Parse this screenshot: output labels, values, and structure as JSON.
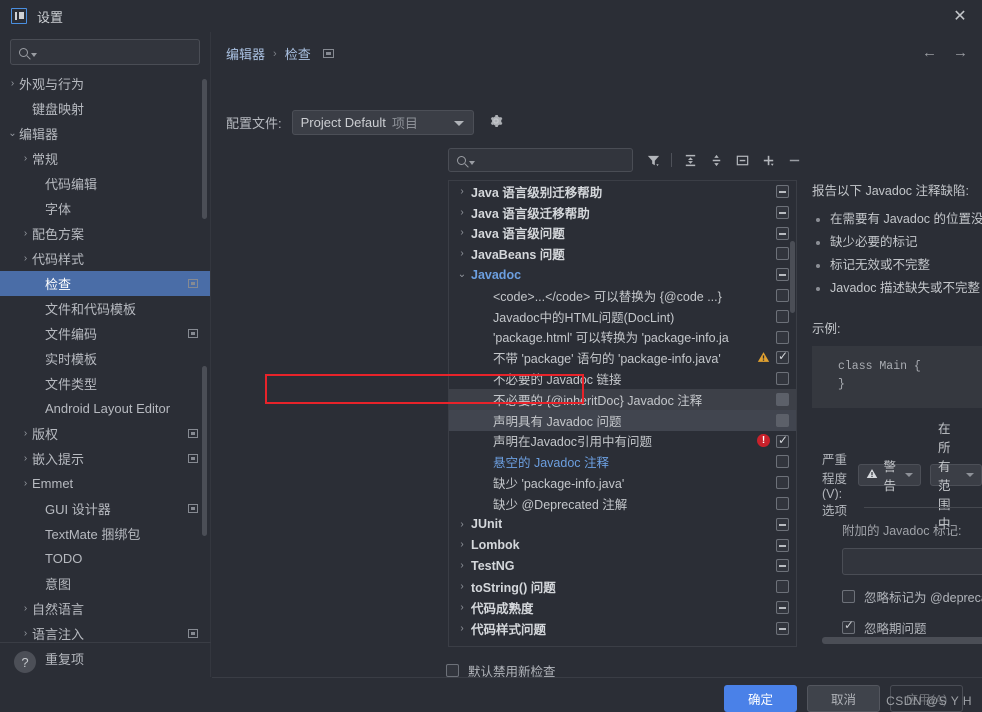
{
  "window": {
    "title": "设置",
    "app_icon": "intellij-idea-icon",
    "close_label": "✕"
  },
  "sidebar": {
    "search_placeholder": "",
    "items": [
      {
        "label": "外观与行为",
        "arrow": "›",
        "indent": 0,
        "selected": false,
        "badge": false
      },
      {
        "label": "键盘映射",
        "arrow": "",
        "indent": 1,
        "selected": false,
        "badge": false
      },
      {
        "label": "编辑器",
        "arrow": "⌄",
        "indent": 0,
        "selected": false,
        "badge": false
      },
      {
        "label": "常规",
        "arrow": "›",
        "indent": 1,
        "selected": false,
        "badge": false
      },
      {
        "label": "代码编辑",
        "arrow": "",
        "indent": 2,
        "selected": false,
        "badge": false
      },
      {
        "label": "字体",
        "arrow": "",
        "indent": 2,
        "selected": false,
        "badge": false
      },
      {
        "label": "配色方案",
        "arrow": "›",
        "indent": 1,
        "selected": false,
        "badge": false
      },
      {
        "label": "代码样式",
        "arrow": "›",
        "indent": 1,
        "selected": false,
        "badge": false
      },
      {
        "label": "检查",
        "arrow": "",
        "indent": 2,
        "selected": true,
        "badge": true
      },
      {
        "label": "文件和代码模板",
        "arrow": "",
        "indent": 2,
        "selected": false,
        "badge": false
      },
      {
        "label": "文件编码",
        "arrow": "",
        "indent": 2,
        "selected": false,
        "badge": true
      },
      {
        "label": "实时模板",
        "arrow": "",
        "indent": 2,
        "selected": false,
        "badge": false
      },
      {
        "label": "文件类型",
        "arrow": "",
        "indent": 2,
        "selected": false,
        "badge": false
      },
      {
        "label": "Android Layout Editor",
        "arrow": "",
        "indent": 2,
        "selected": false,
        "badge": false
      },
      {
        "label": "版权",
        "arrow": "›",
        "indent": 1,
        "selected": false,
        "badge": true
      },
      {
        "label": "嵌入提示",
        "arrow": "›",
        "indent": 1,
        "selected": false,
        "badge": true
      },
      {
        "label": "Emmet",
        "arrow": "›",
        "indent": 1,
        "selected": false,
        "badge": false
      },
      {
        "label": "GUI 设计器",
        "arrow": "",
        "indent": 2,
        "selected": false,
        "badge": true
      },
      {
        "label": "TextMate 捆绑包",
        "arrow": "",
        "indent": 2,
        "selected": false,
        "badge": false
      },
      {
        "label": "TODO",
        "arrow": "",
        "indent": 2,
        "selected": false,
        "badge": false
      },
      {
        "label": "意图",
        "arrow": "",
        "indent": 2,
        "selected": false,
        "badge": false
      },
      {
        "label": "自然语言",
        "arrow": "›",
        "indent": 1,
        "selected": false,
        "badge": false
      },
      {
        "label": "语言注入",
        "arrow": "›",
        "indent": 1,
        "selected": false,
        "badge": true
      },
      {
        "label": "重复项",
        "arrow": "",
        "indent": 2,
        "selected": false,
        "badge": false
      }
    ],
    "help_label": "?"
  },
  "main": {
    "breadcrumb": {
      "parent": "编辑器",
      "separator": "›",
      "current": "检查"
    },
    "nav": {
      "back": "←",
      "forward": "→"
    },
    "profile": {
      "label": "配置文件:",
      "value": "Project Default",
      "value_sub": "项目",
      "gear": "gear-icon"
    },
    "inspection_search_placeholder": "",
    "toolbar": [
      {
        "name": "filter-icon",
        "glyph": "filter"
      },
      {
        "name": "expand-all-icon",
        "glyph": "expand"
      },
      {
        "name": "collapse-all-icon",
        "glyph": "collapse"
      },
      {
        "name": "reset-icon",
        "glyph": "reset"
      },
      {
        "name": "add-icon",
        "glyph": "plus"
      },
      {
        "name": "remove-icon",
        "glyph": "minus"
      }
    ],
    "tree": [
      {
        "label": "Java 语言级别迁移帮助",
        "arrow": "›",
        "indent": 0,
        "group": true,
        "check": "dash",
        "state": ""
      },
      {
        "label": "Java 语言级迁移帮助",
        "arrow": "›",
        "indent": 0,
        "group": true,
        "check": "dash",
        "state": ""
      },
      {
        "label": "Java 语言级问题",
        "arrow": "›",
        "indent": 0,
        "group": true,
        "check": "dash",
        "state": ""
      },
      {
        "label": "JavaBeans 问题",
        "arrow": "›",
        "indent": 0,
        "group": true,
        "check": "empty",
        "state": ""
      },
      {
        "label": "Javadoc",
        "arrow": "⌄",
        "indent": 0,
        "group": true,
        "blue": true,
        "check": "dash",
        "state": ""
      },
      {
        "label": "<code>...</code> 可以替换为 {@code ...}",
        "arrow": "",
        "indent": 1,
        "group": false,
        "check": "empty",
        "state": ""
      },
      {
        "label": "Javadoc中的HTML问题(DocLint)",
        "arrow": "",
        "indent": 1,
        "group": false,
        "check": "empty",
        "state": ""
      },
      {
        "label": "'package.html' 可以转换为 'package-info.ja",
        "arrow": "",
        "indent": 1,
        "group": false,
        "check": "empty",
        "state": ""
      },
      {
        "label": "不带 'package' 语句的 'package-info.java'",
        "arrow": "",
        "indent": 1,
        "group": false,
        "check": "checked",
        "state": "",
        "icon": "warning"
      },
      {
        "label": "不必要的 Javadoc 链接",
        "arrow": "",
        "indent": 1,
        "group": false,
        "check": "empty",
        "state": ""
      },
      {
        "label": "不必要的 {@inheritDoc} Javadoc 注释",
        "arrow": "",
        "indent": 1,
        "group": false,
        "check": "filled",
        "state": "hover"
      },
      {
        "label": "声明具有 Javadoc 问题",
        "arrow": "",
        "indent": 1,
        "group": false,
        "check": "filled",
        "state": "active"
      },
      {
        "label": "声明在Javadoc引用中有问题",
        "arrow": "",
        "indent": 1,
        "group": false,
        "check": "checked",
        "state": "",
        "icon": "error"
      },
      {
        "label": "悬空的 Javadoc 注释",
        "arrow": "",
        "indent": 1,
        "group": false,
        "check": "empty",
        "state": "",
        "link": true
      },
      {
        "label": "缺少 'package-info.java'",
        "arrow": "",
        "indent": 1,
        "group": false,
        "check": "empty",
        "state": ""
      },
      {
        "label": "缺少 @Deprecated 注解",
        "arrow": "",
        "indent": 1,
        "group": false,
        "check": "empty",
        "state": ""
      },
      {
        "label": "JUnit",
        "arrow": "›",
        "indent": 0,
        "group": true,
        "check": "dash",
        "state": ""
      },
      {
        "label": "Lombok",
        "arrow": "›",
        "indent": 0,
        "group": true,
        "check": "dash",
        "state": ""
      },
      {
        "label": "TestNG",
        "arrow": "›",
        "indent": 0,
        "group": true,
        "check": "dash",
        "state": ""
      },
      {
        "label": "toString() 问题",
        "arrow": "›",
        "indent": 0,
        "group": true,
        "check": "empty",
        "state": ""
      },
      {
        "label": "代码成熟度",
        "arrow": "›",
        "indent": 0,
        "group": true,
        "check": "dash",
        "state": ""
      },
      {
        "label": "代码样式问题",
        "arrow": "›",
        "indent": 0,
        "group": true,
        "check": "dash",
        "state": ""
      }
    ],
    "description": {
      "heading": "报告以下 Javadoc 注释缺陷:",
      "bullets": [
        "在需要有 Javadoc 的位置没有 Javadoc",
        "缺少必要的标记",
        "标记无效或不完整",
        "Javadoc 描述缺失或不完整"
      ],
      "example_label": "示例:",
      "code_line1": "class Main {",
      "code_line2": "}"
    },
    "severity": {
      "label": "严重程度(V):",
      "value": "警告",
      "value_icon": "warning-triangle-icon",
      "scope": "在所有范围中"
    },
    "options": {
      "title": "选项",
      "field_label": "附加的 Javadoc 标记:",
      "field_value": "",
      "checkbox1": {
        "label": "忽略标记为 @deprecated 的元素",
        "checked": false
      },
      "checkbox2": {
        "label": "忽略期问题",
        "checked": true
      }
    },
    "disable_new": {
      "label": "默认禁用新检查",
      "checked": false
    }
  },
  "footer": {
    "ok": "确定",
    "cancel": "取消",
    "apply": "应用(A)",
    "watermark": "CSDN @S Y H"
  },
  "colors": {
    "accent": "#4a81e8",
    "selection": "#4a6da7",
    "annotation": "#e8232a",
    "link": "#6c9fe0",
    "background": "#2b2e36"
  }
}
